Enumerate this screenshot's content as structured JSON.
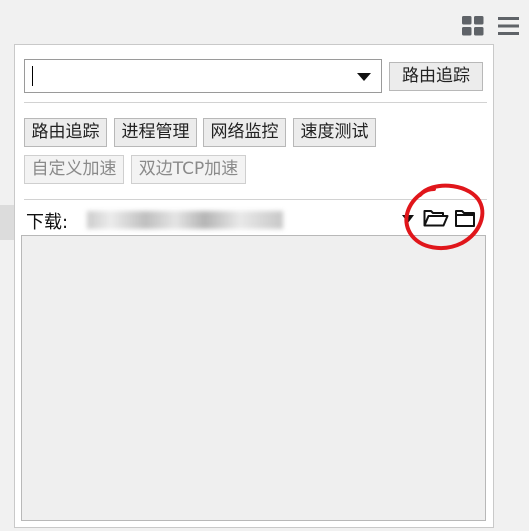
{
  "toolbar": {
    "extension_icon": "grid-icon",
    "menu_icon": "hamburger-menu-icon"
  },
  "popup": {
    "target_input": {
      "value": "",
      "placeholder": ""
    },
    "action_button_label": "路由追踪",
    "tools": [
      {
        "label": "路由追踪",
        "enabled": true
      },
      {
        "label": "进程管理",
        "enabled": true
      },
      {
        "label": "网络监控",
        "enabled": true
      },
      {
        "label": "速度测试",
        "enabled": true
      },
      {
        "label": "自定义加速",
        "enabled": false
      },
      {
        "label": "双边TCP加速",
        "enabled": false
      }
    ],
    "download": {
      "label": "下载:",
      "path_redacted": true,
      "open_folder_icon": "folder-open-icon",
      "folder_icon": "folder-icon"
    },
    "annotation_color": "#e0161b"
  }
}
